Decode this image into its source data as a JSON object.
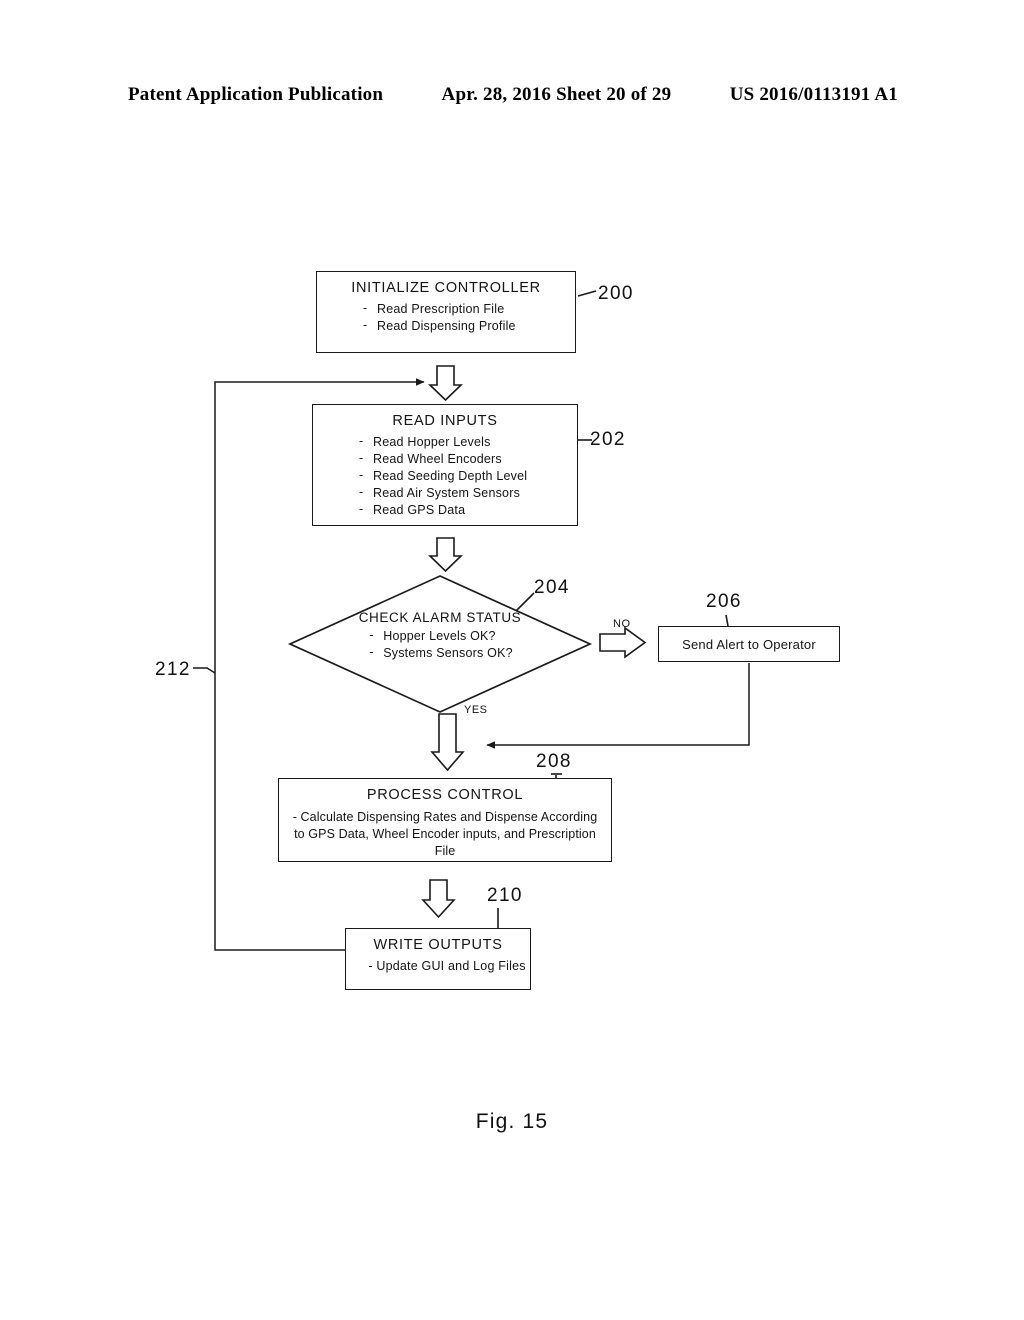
{
  "header": {
    "left": "Patent Application Publication",
    "middle": "Apr. 28, 2016  Sheet 20 of 29",
    "right": "US 2016/0113191 A1"
  },
  "figure": {
    "caption": "Fig. 15"
  },
  "flowchart": {
    "nodes": {
      "initialize": {
        "ref": "200",
        "title": "INITIALIZE CONTROLLER",
        "bullets": [
          "Read Prescription File",
          "Read Dispensing Profile"
        ]
      },
      "read_inputs": {
        "ref": "202",
        "title": "READ INPUTS",
        "bullets": [
          "Read Hopper Levels",
          "Read Wheel Encoders",
          "Read Seeding Depth Level",
          "Read Air System Sensors",
          "Read GPS Data"
        ]
      },
      "check_alarm": {
        "ref": "204",
        "title": "CHECK ALARM STATUS",
        "bullets": [
          "Hopper Levels OK?",
          "Systems Sensors OK?"
        ]
      },
      "send_alert": {
        "ref": "206",
        "title": "Send Alert to Operator"
      },
      "process_control": {
        "ref": "208",
        "title": "PROCESS CONTROL",
        "body": "- Calculate Dispensing Rates and Dispense According to GPS Data, Wheel Encoder inputs, and Prescription File"
      },
      "write_outputs": {
        "ref": "210",
        "title": "WRITE OUTPUTS",
        "bullets": [
          "- Update GUI and Log Files"
        ]
      },
      "feedback_loop": {
        "ref": "212"
      }
    },
    "edge_labels": {
      "no": "NO",
      "yes": "YES"
    }
  },
  "colors": {
    "ink": "#1a1a1a",
    "page": "#ffffff"
  }
}
